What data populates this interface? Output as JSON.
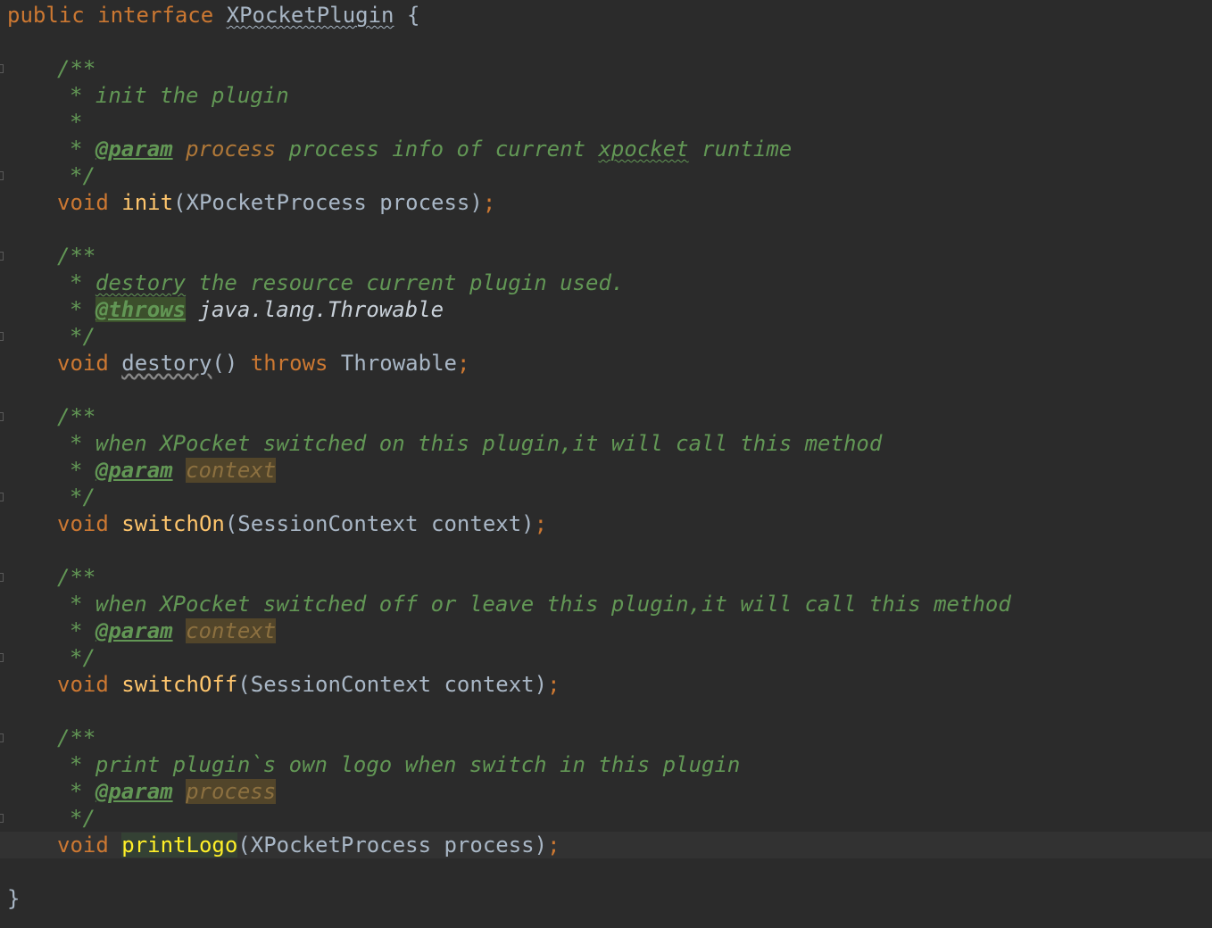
{
  "colors": {
    "background": "#2b2b2b",
    "keyword": "#cc7832",
    "function": "#ffc66d",
    "doc_comment": "#629755",
    "default": "#a9b7c6",
    "current_line": "#323232"
  },
  "code": {
    "header": {
      "kw_public": "public",
      "kw_interface": "interface",
      "name": "XPocketPlugin",
      "brace": "{"
    },
    "init": {
      "doc_open": "/**",
      "line1": "* init the plugin",
      "line2": "*",
      "star": "*",
      "tag": "@param",
      "pname": "process",
      "desc_a": "process info of current",
      "desc_word": "xpocket",
      "desc_b": "runtime",
      "doc_close": "*/",
      "kw_void": "void",
      "method": "init",
      "params": "(XPocketProcess process)",
      "semi": ";"
    },
    "destory": {
      "doc_open": "/**",
      "star1": "*",
      "word": "destory",
      "desc": "the resource current plugin used.",
      "star2": "*",
      "tag": "@throws",
      "throws_type": "java.lang.Throwable",
      "doc_close": "*/",
      "kw_void": "void",
      "method": "destory",
      "parens": "()",
      "kw_throws": "throws",
      "type": "Throwable",
      "semi": ";"
    },
    "switch_on": {
      "doc_open": "/**",
      "line1": "* when XPocket switched on this plugin,it will call this method",
      "star": "*",
      "tag": "@param",
      "pname": "context",
      "doc_close": "*/",
      "kw_void": "void",
      "method": "switchOn",
      "params": "(SessionContext context)",
      "semi": ";"
    },
    "switch_off": {
      "doc_open": "/**",
      "line1": "* when XPocket switched off or leave this plugin,it will call this method",
      "star": "*",
      "tag": "@param",
      "pname": "context",
      "doc_close": "*/",
      "kw_void": "void",
      "method": "switchOff",
      "params": "(SessionContext context)",
      "semi": ";"
    },
    "print_logo": {
      "doc_open": "/**",
      "line1": "* print plugin`s own logo when switch in this plugin",
      "star": "*",
      "tag": "@param",
      "pname": "process",
      "doc_close": "*/",
      "kw_void": "void",
      "method": "printLogo",
      "params": "(XPocketProcess process)",
      "semi": ";"
    },
    "closing_brace": "}"
  }
}
